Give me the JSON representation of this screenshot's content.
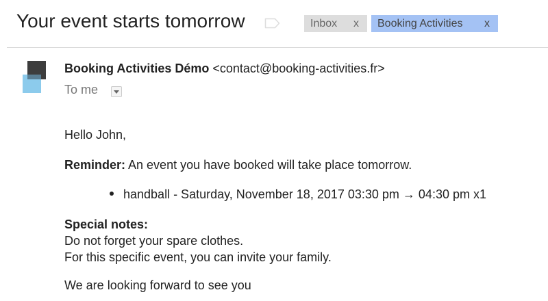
{
  "email": {
    "subject": "Your event starts tomorrow",
    "labels": [
      {
        "label": "Inbox",
        "remove": "x"
      },
      {
        "label": "Booking Activities",
        "remove": "x"
      }
    ],
    "sender": {
      "name": "Booking Activities Démo",
      "email": "<contact@booking-activities.fr>"
    },
    "to": "To me",
    "body": {
      "greeting": "Hello John,",
      "reminder_label": "Reminder:",
      "reminder_text": " An event you have booked will take place tomorrow.",
      "event_item": "handball - Saturday, November 18, 2017 03:30 pm → 04:30 pm x1",
      "notes_title": "Special notes:",
      "notes_lines": [
        "Do not forget your spare clothes.",
        "For this specific event, you can invite your family."
      ],
      "closing": "We are looking forward to see you"
    }
  },
  "colors": {
    "inbox_chip_bg": "#dddddd",
    "booking_chip_bg": "#a4c2f4",
    "avatar_dark": "#3d3d3d",
    "avatar_light": "#8ccbec"
  },
  "icons": {
    "label_tag": "label-tag-icon",
    "to_dropdown": "chevron-down-icon"
  }
}
